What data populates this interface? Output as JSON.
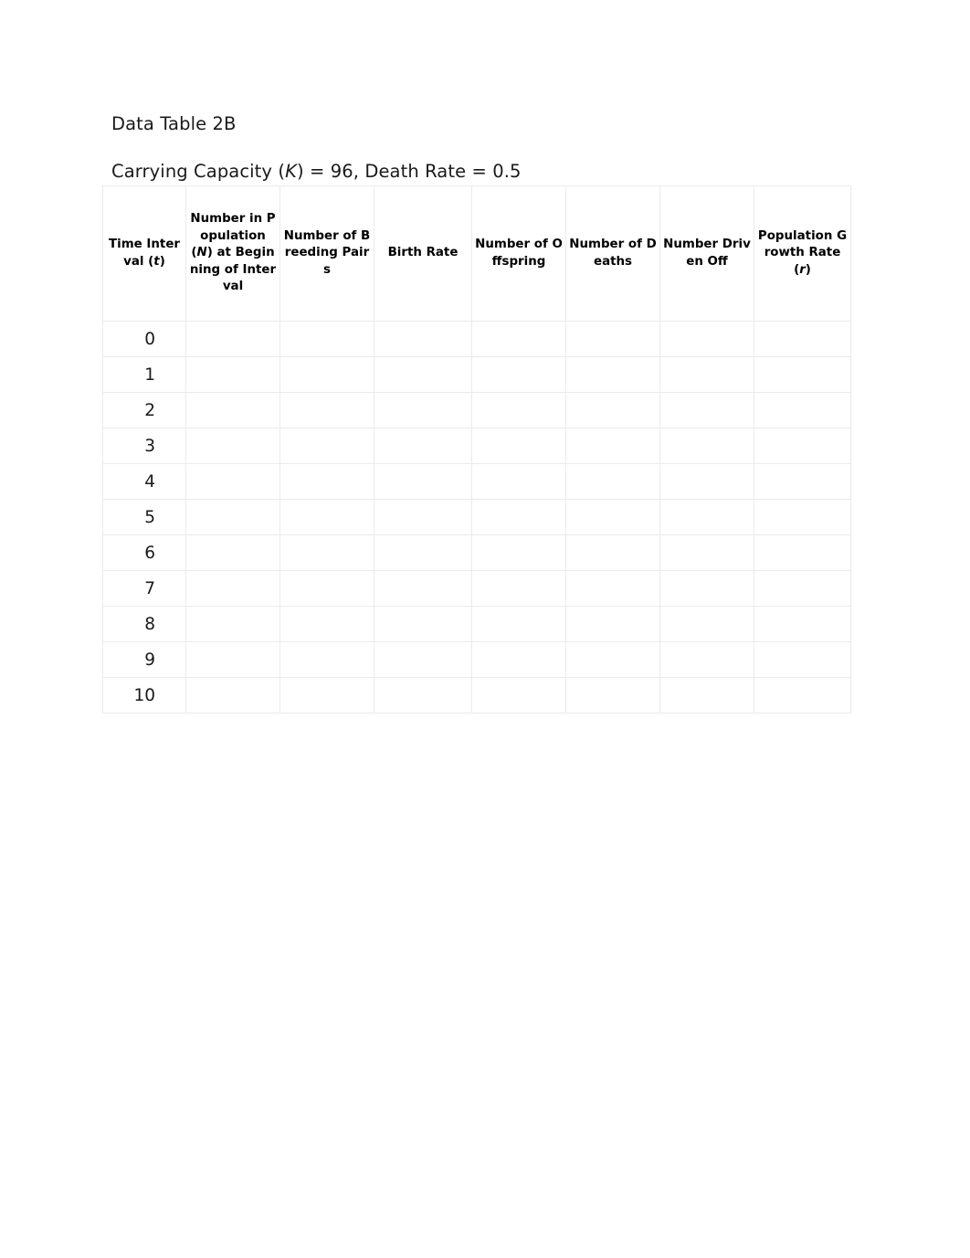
{
  "document": {
    "title": "Data Table 2B",
    "subtitle_prefix": "Carrying Capacity (",
    "subtitle_k": "K",
    "subtitle_suffix": ") = 96, Death Rate = 0.5",
    "carrying_capacity": 96,
    "death_rate": 0.5
  },
  "table": {
    "columns": [
      {
        "key": "time_interval",
        "label_pre": "Time Interval (",
        "label_italic": "t",
        "label_post": ")"
      },
      {
        "key": "population_n",
        "label_pre": "Number in Population (",
        "label_italic": "N",
        "label_post": ") at Beginning of Interval"
      },
      {
        "key": "breeding_pairs",
        "label_pre": "Number of Breeding Pairs",
        "label_italic": "",
        "label_post": ""
      },
      {
        "key": "birth_rate",
        "label_pre": "Birth Rate",
        "label_italic": "",
        "label_post": ""
      },
      {
        "key": "offspring",
        "label_pre": "Number of Offspring",
        "label_italic": "",
        "label_post": ""
      },
      {
        "key": "deaths",
        "label_pre": "Number of Deaths",
        "label_italic": "",
        "label_post": ""
      },
      {
        "key": "driven_off",
        "label_pre": "Number Driven Off",
        "label_italic": "",
        "label_post": ""
      },
      {
        "key": "growth_rate",
        "label_pre": "Population Growth Rate (",
        "label_italic": "r",
        "label_post": ")"
      }
    ],
    "rows": [
      {
        "time_interval": "0",
        "population_n": "",
        "breeding_pairs": "",
        "birth_rate": "",
        "offspring": "",
        "deaths": "",
        "driven_off": "",
        "growth_rate": ""
      },
      {
        "time_interval": "1",
        "population_n": "",
        "breeding_pairs": "",
        "birth_rate": "",
        "offspring": "",
        "deaths": "",
        "driven_off": "",
        "growth_rate": ""
      },
      {
        "time_interval": "2",
        "population_n": "",
        "breeding_pairs": "",
        "birth_rate": "",
        "offspring": "",
        "deaths": "",
        "driven_off": "",
        "growth_rate": ""
      },
      {
        "time_interval": "3",
        "population_n": "",
        "breeding_pairs": "",
        "birth_rate": "",
        "offspring": "",
        "deaths": "",
        "driven_off": "",
        "growth_rate": ""
      },
      {
        "time_interval": "4",
        "population_n": "",
        "breeding_pairs": "",
        "birth_rate": "",
        "offspring": "",
        "deaths": "",
        "driven_off": "",
        "growth_rate": ""
      },
      {
        "time_interval": "5",
        "population_n": "",
        "breeding_pairs": "",
        "birth_rate": "",
        "offspring": "",
        "deaths": "",
        "driven_off": "",
        "growth_rate": ""
      },
      {
        "time_interval": "6",
        "population_n": "",
        "breeding_pairs": "",
        "birth_rate": "",
        "offspring": "",
        "deaths": "",
        "driven_off": "",
        "growth_rate": ""
      },
      {
        "time_interval": "7",
        "population_n": "",
        "breeding_pairs": "",
        "birth_rate": "",
        "offspring": "",
        "deaths": "",
        "driven_off": "",
        "growth_rate": ""
      },
      {
        "time_interval": "8",
        "population_n": "",
        "breeding_pairs": "",
        "birth_rate": "",
        "offspring": "",
        "deaths": "",
        "driven_off": "",
        "growth_rate": ""
      },
      {
        "time_interval": "9",
        "population_n": "",
        "breeding_pairs": "",
        "birth_rate": "",
        "offspring": "",
        "deaths": "",
        "driven_off": "",
        "growth_rate": ""
      },
      {
        "time_interval": "10",
        "population_n": "",
        "breeding_pairs": "",
        "birth_rate": "",
        "offspring": "",
        "deaths": "",
        "driven_off": "",
        "growth_rate": ""
      }
    ]
  }
}
